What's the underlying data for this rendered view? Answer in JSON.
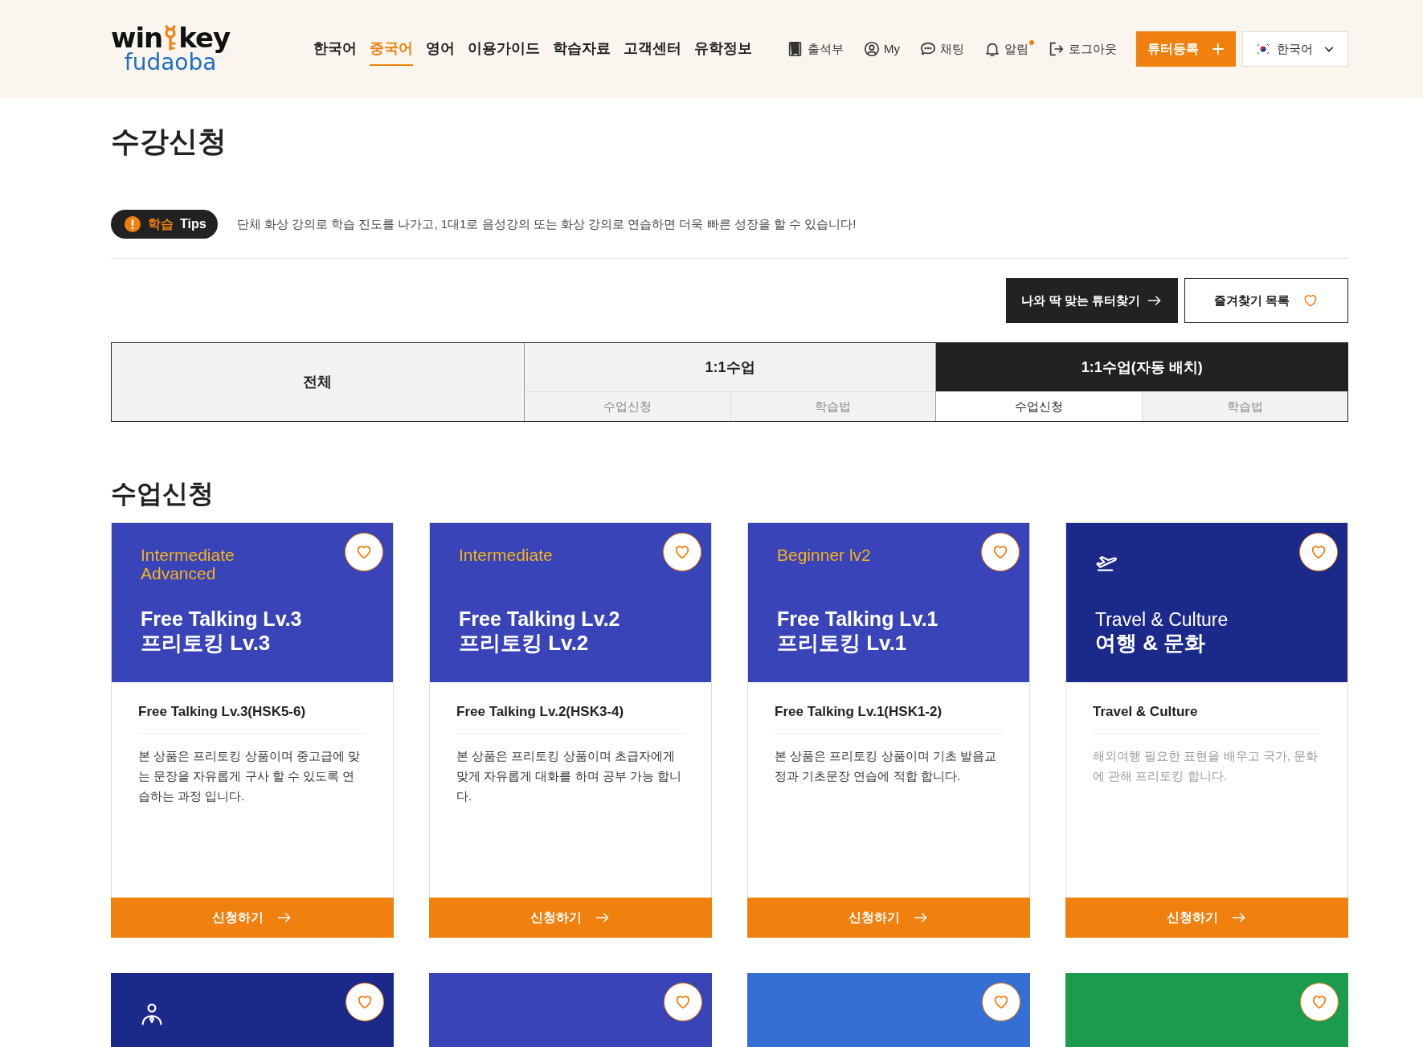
{
  "header": {
    "logo": {
      "word_start": "win",
      "word_end": "key",
      "sub": "fudaoba"
    },
    "nav": [
      {
        "label": "한국어",
        "selected": false
      },
      {
        "label": "중국어",
        "selected": true
      },
      {
        "label": "영어",
        "selected": false
      },
      {
        "label": "이용가이드",
        "selected": false
      },
      {
        "label": "학습자료",
        "selected": false
      },
      {
        "label": "고객센터",
        "selected": false
      },
      {
        "label": "유학정보",
        "selected": false
      }
    ],
    "utilities": [
      {
        "kind": "attendance",
        "label": "출석부"
      },
      {
        "kind": "my",
        "label": "My"
      },
      {
        "kind": "chat",
        "label": "채팅"
      },
      {
        "kind": "alarm",
        "label": "알림",
        "unread": true
      },
      {
        "kind": "logout",
        "label": "로그아웃"
      }
    ],
    "tutor_button": "튜터등록",
    "language": "한국어"
  },
  "page_title": "수강신청",
  "tips": {
    "badge_accent": "학습",
    "badge_text": "Tips",
    "text": "단체 화상 강의로 학습 진도를 나가고, 1대1로 음성강의 또는 화상 강의로 연습하면 더욱 빠른 성장을 할 수 있습니다!"
  },
  "actions": {
    "find_tutor": "나와 딱 맞는 튜터찾기",
    "favorites": "즐겨찾기 목록"
  },
  "tabs": [
    {
      "label": "전체",
      "selected": false
    },
    {
      "label": "1:1수업",
      "selected": false,
      "children": [
        {
          "label": "수업신청",
          "selected": false
        },
        {
          "label": "학습법",
          "selected": false
        }
      ]
    },
    {
      "label": "1:1수업(자동 배치)",
      "selected": true,
      "children": [
        {
          "label": "수업신청",
          "selected": true
        },
        {
          "label": "학습법",
          "selected": false
        }
      ]
    }
  ],
  "section_title": "수업신청",
  "cards": [
    {
      "color": "#3844b8",
      "level": "Intermediate\nAdvanced",
      "title_en": "Free Talking Lv.3",
      "title_ko": "프리토킹 Lv.3",
      "name": "Free Talking Lv.3(HSK5-6)",
      "description": "본 상품은 프리토킹 상품이며 중고급에 맞는 문장을 자유롭게 구사 할 수 있도록 연습하는 과정 입니다.",
      "muted": false,
      "button": "신청하기"
    },
    {
      "color": "#3844b8",
      "level": "Intermediate",
      "title_en": "Free Talking Lv.2",
      "title_ko": "프리토킹 Lv.2",
      "name": "Free Talking Lv.2(HSK3-4)",
      "description": "본 상품은 프리토킹 상품이며 초급자에게 맞게 자유롭게 대화를 하며 공부 가능 합니다.",
      "muted": false,
      "button": "신청하기"
    },
    {
      "color": "#3844b8",
      "level": "Beginner lv2",
      "title_en": "Free Talking Lv.1",
      "title_ko": "프리토킹 Lv.1",
      "name": "Free Talking Lv.1(HSK1-2)",
      "description": "본 상품은 프리토킹 상품이며 기초 발음교정과 기초문장 연습에 적합 합니다.",
      "muted": false,
      "button": "신청하기"
    },
    {
      "color": "#1b2a8a",
      "kind": "travel",
      "title_en": "Travel & Culture",
      "title_ko": "여행 & 문화",
      "name": "Travel & Culture",
      "description": "해외여행 필요한 표현을 배우고 국가, 문화에 관해 프리토킹 합니다.",
      "muted": true,
      "button": "신청하기"
    },
    {
      "color": "#1b2a8a",
      "kind": "business"
    },
    {
      "color": "#3844b8"
    },
    {
      "color": "#366fd3"
    },
    {
      "color": "#1a9b4e"
    }
  ]
}
